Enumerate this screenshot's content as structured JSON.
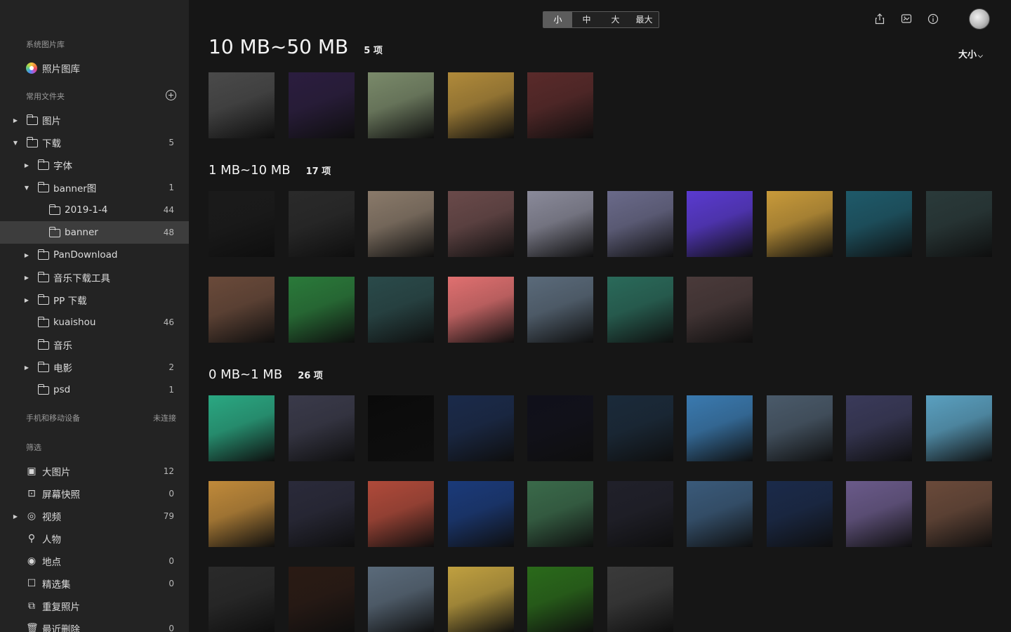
{
  "sidebar": {
    "system_library_header": "系统图片库",
    "photo_library": "照片图库",
    "common_folders_header": "常用文件夹",
    "folders": [
      {
        "label": "图片",
        "count": "",
        "level": 0,
        "arrow": "right"
      },
      {
        "label": "下载",
        "count": "5",
        "level": 0,
        "arrow": "down"
      },
      {
        "label": "字体",
        "count": "",
        "level": 1,
        "arrow": "right"
      },
      {
        "label": "banner图",
        "count": "1",
        "level": 1,
        "arrow": "down"
      },
      {
        "label": "2019-1-4",
        "count": "44",
        "level": 2,
        "arrow": ""
      },
      {
        "label": "banner",
        "count": "48",
        "level": 2,
        "arrow": "",
        "selected": true
      },
      {
        "label": "PanDownload",
        "count": "",
        "level": 1,
        "arrow": "right"
      },
      {
        "label": "音乐下载工具",
        "count": "",
        "level": 1,
        "arrow": "right"
      },
      {
        "label": "PP 下载",
        "count": "",
        "level": 1,
        "arrow": "right"
      },
      {
        "label": "kuaishou",
        "count": "46",
        "level": 1,
        "arrow": ""
      },
      {
        "label": "音乐",
        "count": "",
        "level": 1,
        "arrow": ""
      },
      {
        "label": "电影",
        "count": "2",
        "level": 1,
        "arrow": "right"
      },
      {
        "label": "psd",
        "count": "1",
        "level": 1,
        "arrow": ""
      }
    ],
    "devices_header": "手机和移动设备",
    "devices_status": "未连接",
    "filter_header": "筛选",
    "filters": [
      {
        "label": "大图片",
        "count": "12",
        "icon": "image-icon"
      },
      {
        "label": "屏幕快照",
        "count": "0",
        "icon": "screenshot-icon"
      },
      {
        "label": "视频",
        "count": "79",
        "icon": "video-icon",
        "arrow": "right"
      },
      {
        "label": "人物",
        "count": "",
        "icon": "person-icon"
      },
      {
        "label": "地点",
        "count": "0",
        "icon": "location-icon"
      },
      {
        "label": "精选集",
        "count": "0",
        "icon": "collection-icon"
      },
      {
        "label": "重复照片",
        "count": "",
        "icon": "duplicate-icon"
      },
      {
        "label": "最近删除",
        "count": "0",
        "icon": "trash-icon"
      }
    ]
  },
  "toolbar": {
    "sizes": [
      "小",
      "中",
      "大",
      "最大"
    ],
    "active_size": "小",
    "sort_label": "大小"
  },
  "groups": [
    {
      "title": "10 MB~50 MB",
      "count": "5 项"
    },
    {
      "title": "1 MB~10 MB",
      "count": "17 项"
    },
    {
      "title": "0 MB~1 MB",
      "count": "26 项"
    }
  ],
  "thumbnail_colors": {
    "group1": [
      "#4a4a4a",
      "#2b1d3f",
      "#7a8a6a",
      "#b08a3a",
      "#5a2a2a"
    ],
    "group2": [
      "#1a1a1a",
      "#2a2a2a",
      "#8a7a6a",
      "#6a4a4a",
      "#8a8a9a",
      "#6a6a8a",
      "#5a3ad0",
      "#c89a3a",
      "#1e5a6a",
      "#2a3a3a",
      "#6a4a3a",
      "#2a7a3a",
      "#2a4a4a",
      "#e07070",
      "#5a6a7a",
      "#2a6a5a",
      "#4a3a3a"
    ],
    "group3": [
      "#2aa882",
      "#3a3a4a",
      "#0a0a0a",
      "#1a2a4a",
      "#10101a",
      "#1a2a3a",
      "#3a7ab0",
      "#4a5a6a",
      "#3a3a5a",
      "#5aa0c0",
      "#c08a3a",
      "#2a2a3a",
      "#b04a3a",
      "#1a3a7a",
      "#3a6a4a",
      "#20202a",
      "#3a5a7a",
      "#1a2a4a",
      "#6a5a8a",
      "#6a4a3a",
      "#2a2a2a",
      "#2a1a14",
      "#5a6a7a",
      "#c0a040",
      "#2a6a1a",
      "#3a3a3a"
    ]
  }
}
